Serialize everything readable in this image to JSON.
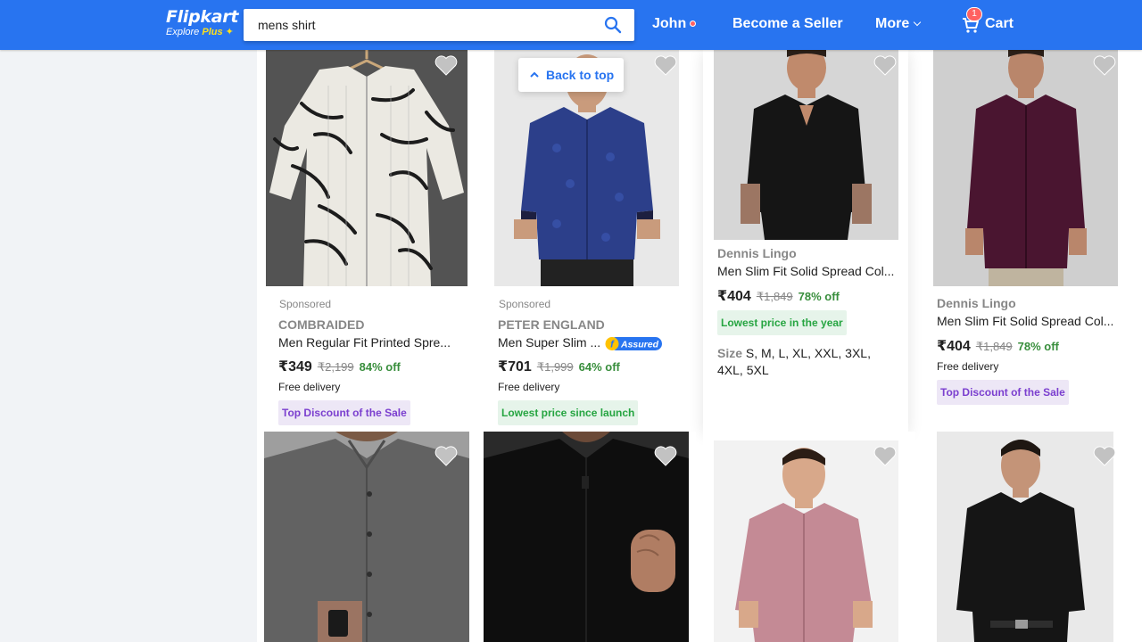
{
  "header": {
    "logo_main": "Flipkart",
    "logo_explore": "Explore",
    "logo_plus": "Plus",
    "search_value": "mens shirt",
    "user_name": "John",
    "become_seller": "Become a Seller",
    "more": "More",
    "cart_label": "Cart",
    "cart_count": "1"
  },
  "back_to_top": "Back to top",
  "products": [
    {
      "sponsored": "Sponsored",
      "brand": "COMBRAIDED",
      "title": "Men Regular Fit Printed Spre...",
      "price": "₹349",
      "mrp": "₹2,199",
      "off": "84% off",
      "delivery": "Free delivery",
      "tag": "Top Discount of the Sale"
    },
    {
      "sponsored": "Sponsored",
      "brand": "PETER ENGLAND",
      "title": "Men Super Slim ...",
      "assured": "Assured",
      "price": "₹701",
      "mrp": "₹1,999",
      "off": "64% off",
      "delivery": "Free delivery",
      "tag": "Lowest price since launch"
    },
    {
      "brand": "Dennis Lingo",
      "title": "Men Slim Fit Solid Spread Col...",
      "price": "₹404",
      "mrp": "₹1,849",
      "off": "78% off",
      "tag": "Lowest price in the year",
      "size_label": "Size",
      "sizes_line1": "S, M, L, XL, XXL, 3XL,",
      "sizes_line2": "4XL, 5XL"
    },
    {
      "brand": "Dennis Lingo",
      "title": "Men Slim Fit Solid Spread Col...",
      "price": "₹404",
      "mrp": "₹1,849",
      "off": "78% off",
      "delivery": "Free delivery",
      "tag": "Top Discount of the Sale"
    }
  ],
  "colors": {
    "brand_blue": "#2874f0",
    "discount_green": "#388e3c",
    "tag_purple": "#7b3fcf",
    "badge_red": "#ff6161"
  }
}
